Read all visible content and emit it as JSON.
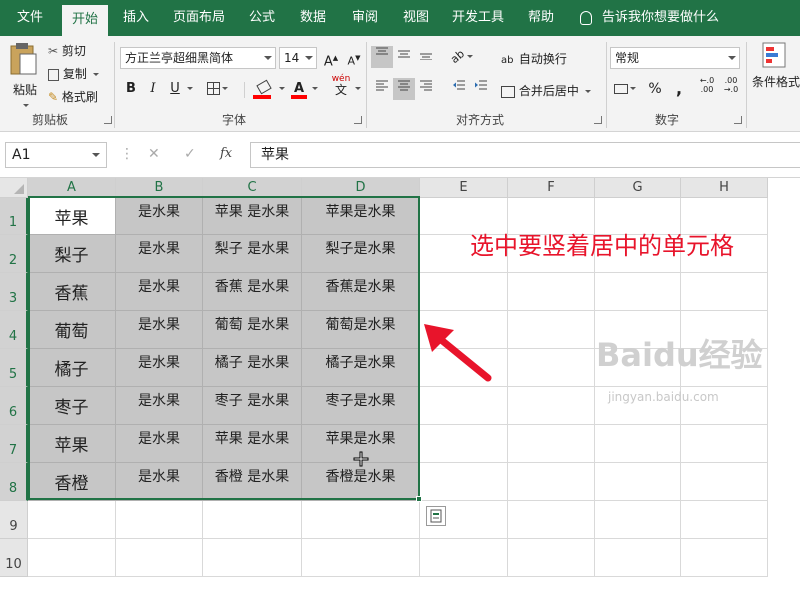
{
  "tabs": [
    {
      "label": "文件",
      "active": false
    },
    {
      "label": "开始",
      "active": true
    },
    {
      "label": "插入",
      "active": false
    },
    {
      "label": "页面布局",
      "active": false
    },
    {
      "label": "公式",
      "active": false
    },
    {
      "label": "数据",
      "active": false
    },
    {
      "label": "审阅",
      "active": false
    },
    {
      "label": "视图",
      "active": false
    },
    {
      "label": "开发工具",
      "active": false
    },
    {
      "label": "帮助",
      "active": false
    }
  ],
  "tell_me": "告诉我你想要做什么",
  "ribbon": {
    "clipboard": {
      "paste": "粘贴",
      "cut": "剪切",
      "copy": "复制",
      "format_painter": "格式刷",
      "label": "剪贴板"
    },
    "font": {
      "name": "方正兰亭超细黑简体",
      "size": "14",
      "bold": "B",
      "italic": "I",
      "underline": "U",
      "phonetic_top": "wén",
      "phonetic_bottom": "文",
      "label": "字体"
    },
    "alignment": {
      "wrap": "自动换行",
      "merge": "合并后居中",
      "label": "对齐方式"
    },
    "number": {
      "format": "常规",
      "percent": "%",
      "comma": ",",
      "inc": "←.0\n.00",
      "label": "数字"
    },
    "styles": {
      "conditional": "条件格式"
    }
  },
  "formula_bar": {
    "name_box": "A1",
    "cancel": "✕",
    "enter": "✓",
    "fx": "fx",
    "value": "苹果"
  },
  "columns": [
    "A",
    "B",
    "C",
    "D",
    "E",
    "F",
    "G",
    "H"
  ],
  "rows": [
    "1",
    "2",
    "3",
    "4",
    "5",
    "6",
    "7",
    "8",
    "9",
    "10"
  ],
  "cells": [
    [
      "苹果",
      "是水果",
      "苹果  是水果",
      "苹果是水果"
    ],
    [
      "梨子",
      "是水果",
      "梨子 是水果",
      "梨子是水果"
    ],
    [
      "香蕉",
      "是水果",
      "香蕉 是水果",
      "香蕉是水果"
    ],
    [
      "葡萄",
      "是水果",
      "葡萄 是水果",
      "葡萄是水果"
    ],
    [
      "橘子",
      "是水果",
      "橘子  是水果",
      "橘子是水果"
    ],
    [
      "枣子",
      "是水果",
      "枣子 是水果",
      "枣子是水果"
    ],
    [
      "苹果",
      "是水果",
      "苹果 是水果",
      "苹果是水果"
    ],
    [
      "香橙",
      "是水果",
      "香橙 是水果",
      "香橙是水果"
    ]
  ],
  "annotation": "选中要竖着居中的单元格",
  "watermark": {
    "brand": "Baidu经验",
    "url": "jingyan.baidu.com"
  },
  "colors": {
    "accent": "#217346",
    "annotation": "#e8142b",
    "selection": "#c6c6c6"
  }
}
